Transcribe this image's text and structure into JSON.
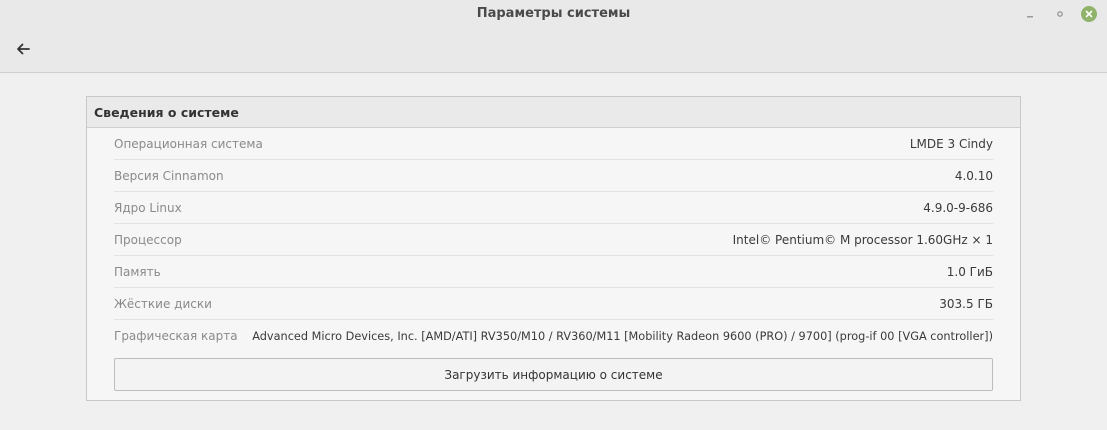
{
  "window": {
    "title": "Параметры системы"
  },
  "icons": {
    "back": "arrow-left-icon",
    "minimize": "minimize-icon",
    "maximize": "restore-icon",
    "close": "close-icon"
  },
  "colors": {
    "close_button": "#8fb36a"
  },
  "panel": {
    "header": "Сведения о системе",
    "rows": [
      {
        "label": "Операционная система",
        "value": "LMDE 3 Cindy"
      },
      {
        "label": "Версия Cinnamon",
        "value": "4.0.10"
      },
      {
        "label": "Ядро Linux",
        "value": "4.9.0-9-686"
      },
      {
        "label": "Процессор",
        "value": "Intel© Pentium© M processor 1.60GHz × 1"
      },
      {
        "label": "Память",
        "value": "1.0 ГиБ"
      },
      {
        "label": "Жёсткие диски",
        "value": "303.5 ГБ"
      },
      {
        "label": "Графическая карта",
        "value": "Advanced Micro Devices, Inc. [AMD/ATI] RV350/M10 / RV360/M11 [Mobility Radeon 9600 (PRO) / 9700] (prog-if 00 [VGA controller])"
      }
    ],
    "upload_button": "Загрузить информацию о системе"
  }
}
